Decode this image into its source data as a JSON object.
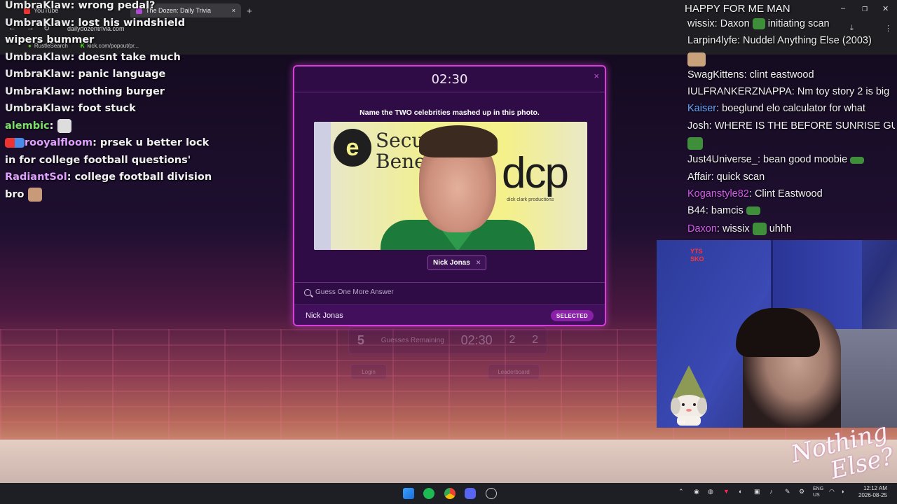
{
  "browser": {
    "tabs": [
      "YouTube",
      "The Dozen: Daily Trivia"
    ],
    "url": "dailydozentrivia.com",
    "bookmarks": [
      "RustleSearch",
      "kick.com/popout/pr..."
    ],
    "new_tab_symbol": "+"
  },
  "chat_left": [
    {
      "user": "UmbraKlaw",
      "text": "wrong pedal?"
    },
    {
      "user": "UmbraKlaw",
      "text": "lost his windshield wipers bummer"
    },
    {
      "user": "UmbraKlaw",
      "text": "doesnt take much"
    },
    {
      "user": "UmbraKlaw",
      "text": "panic language"
    },
    {
      "user": "UmbraKlaw",
      "text": "nothing burger"
    },
    {
      "user": "UmbraKlaw",
      "text": "foot stuck"
    },
    {
      "user": "alembic",
      "text": ""
    },
    {
      "user": "rooyalfloom",
      "text": "prsek u better lock in for college football questions'"
    },
    {
      "user": "RadiantSol",
      "text": "college football division bro"
    }
  ],
  "chat_right": {
    "header": "HAPPY FOR ME MAN",
    "lines": [
      {
        "user": "wissix",
        "text": "Daxon",
        "text2": "initiating scan"
      },
      {
        "user": "Larpin4lyfe",
        "text": "Nuddel Anything Else (2003)"
      },
      {
        "user": "SwagKittens",
        "text": "clint eastwood"
      },
      {
        "user": "IULFRANKERZNAPPA",
        "text": "Nm toy story 2 is big"
      },
      {
        "user": "Kaiser",
        "text": "boeglund elo calculator for what"
      },
      {
        "user": "Josh",
        "text": "WHERE IS THE BEFORE SUNRISE GUY"
      },
      {
        "user": "Just4Universe_",
        "text": "bean good moobie"
      },
      {
        "user": "Affair",
        "text": "quick scan"
      },
      {
        "user": "Koganstyle82",
        "text": "Clint Eastwood"
      },
      {
        "user": "B44",
        "text": "bamcis"
      },
      {
        "user": "Daxon",
        "text": "wissix",
        "text2": "uhhh"
      }
    ]
  },
  "modal": {
    "timer": "02:30",
    "prompt": "Name the TWO celebrities mashed up in this photo.",
    "chip_label": "Nick Jonas",
    "search_placeholder": "Guess One More Answer",
    "result_name": "Nick Jonas",
    "result_badge": "SELECTED"
  },
  "photo_text": {
    "secur": "Secur",
    "bene": "Bene",
    "dcp": "dcp",
    "dcp_sub": "dick clark productions"
  },
  "background_page": {
    "stat_count": "5",
    "stat_label": "Guesses Remaining",
    "timer": "02:30",
    "stat2": "2",
    "stat3": "2",
    "btn_left": "Login",
    "btn_right": "Leaderboard"
  },
  "webcam": {
    "sticker_text": "YTS\nSKO",
    "tag": "emi"
  },
  "overlay": {
    "brand": "Nothing Else?"
  },
  "taskbar": {
    "lang": "ENG\nUS",
    "time": "12:12 AM",
    "date": "2026-08-25"
  },
  "colors": {
    "modal_border": "#d63fd8",
    "modal_bg": "#2f0c46",
    "badge": "#8a1fa8"
  }
}
